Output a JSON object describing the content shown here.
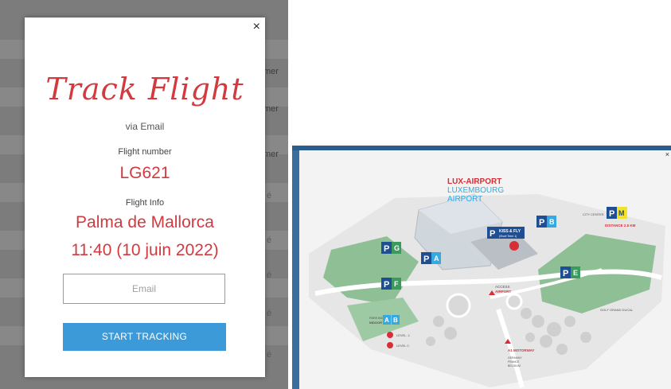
{
  "left_panel": {
    "background_rows": [
      {
        "text": "mer"
      },
      {
        "text": "mer"
      },
      {
        "text": "mer"
      },
      {
        "text": "é"
      },
      {
        "text": "é"
      },
      {
        "text": "é"
      },
      {
        "text": "é"
      },
      {
        "text": "é"
      }
    ],
    "modal": {
      "close_label": "×",
      "title": "Track Flight",
      "subtitle": "via Email",
      "flight_number_label": "Flight number",
      "flight_number": "LG621",
      "flight_info_label": "Flight Info",
      "destination": "Palma de Mallorca",
      "departure": "11:40 (10 juin 2022)",
      "email_placeholder": "Email",
      "email_value": "",
      "button_label": "START TRACKING"
    },
    "colors": {
      "accent_red": "#d23a3f",
      "button_blue": "#3d9ad9"
    }
  },
  "right_panel": {
    "close_label": "×",
    "map": {
      "brand_line1": "LUX-AIRPORT",
      "brand_line2": "LUXEMBOURG",
      "brand_line3": "AIRPORT",
      "parking_letters": [
        "G",
        "A",
        "F",
        "B",
        "E",
        "M"
      ],
      "kiss_fly_line1": "KISS & FLY",
      "kiss_fly_line2": "(Short Term 1)",
      "city_center": "CITY CENTER",
      "distance": "DISTANCE 2.5 KM",
      "access_line1": "ACCESS",
      "access_line2": "AIRPORT",
      "golf_label": "GOLF GRAND DUCAL",
      "parking_indoor_line1": "PARKING",
      "parking_indoor_line2": "INDOOR",
      "indoor_letters": [
        "A",
        "B"
      ],
      "level_minus1": "LEVEL -1",
      "level_0": "LEVEL 0",
      "motorway": "A1 MOTORWAY",
      "dest_line1": "GERMANY",
      "dest_line2": "FRANCE",
      "dest_line3": "BELGIUM"
    },
    "colors": {
      "brand_red": "#d62f37",
      "brand_blue": "#35a9e0",
      "parking_navy": "#1f4e93",
      "parking_green": "#3b9a5c",
      "parking_yellow": "#f2e22c"
    }
  }
}
